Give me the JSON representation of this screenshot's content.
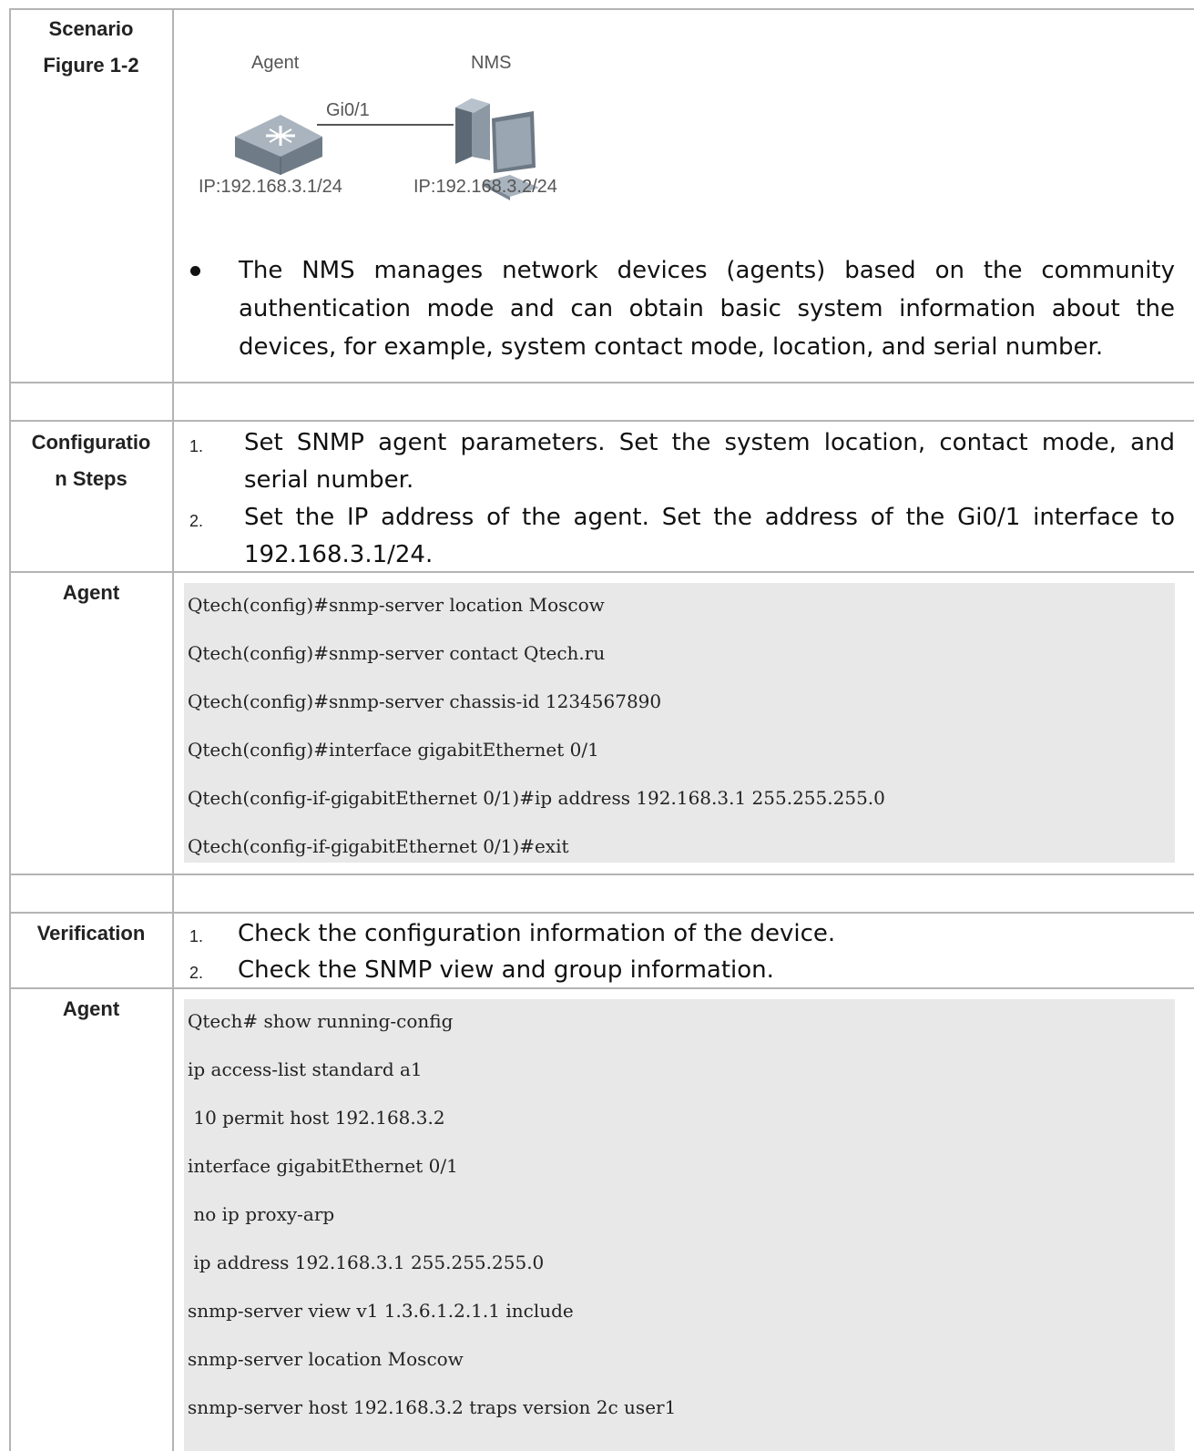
{
  "rows": {
    "scenario": {
      "label_line1": "Scenario",
      "label_line2": "Figure 1-2"
    },
    "config_steps": {
      "label_line1": "Configuratio",
      "label_line2": "n Steps"
    },
    "agent1": {
      "label": "Agent"
    },
    "verification": {
      "label": "Verification"
    },
    "agent2": {
      "label": "Agent"
    }
  },
  "figure": {
    "agent_label": "Agent",
    "nms_label": "NMS",
    "port_label": "Gi0/1",
    "agent_ip": "IP:192.168.3.1/24",
    "nms_ip": "IP:192.168.3.2/24",
    "switch_icon": "switch-icon",
    "pc_icon": "pc-icon"
  },
  "scenario_bullet": "The NMS manages network devices (agents) based on the community authentication mode and can obtain basic system information about the devices, for example, system contact mode, location, and serial number.",
  "config_steps": [
    {
      "num": "1.",
      "text": "Set SNMP agent parameters. Set the system location, contact mode, and serial number."
    },
    {
      "num": "2.",
      "text": "Set the IP address of the agent. Set the address of the Gi0/1 interface to 192.168.3.1/24."
    }
  ],
  "agent_config_code": [
    "Qtech(config)#snmp-server location Moscow",
    "Qtech(config)#snmp-server contact Qtech.ru",
    "Qtech(config)#snmp-server chassis-id 1234567890",
    "Qtech(config)#interface gigabitEthernet 0/1",
    "Qtech(config-if-gigabitEthernet 0/1)#ip address 192.168.3.1 255.255.255.0",
    "Qtech(config-if-gigabitEthernet 0/1)#exit"
  ],
  "verification_steps": [
    {
      "num": "1.",
      "text": "Check the configuration information of the device."
    },
    {
      "num": "2.",
      "text": "Check the SNMP view and group information."
    }
  ],
  "verification_code": [
    "Qtech# show running-config",
    "ip access-list standard a1",
    " 10 permit host 192.168.3.2",
    "interface gigabitEthernet 0/1",
    " no ip proxy-arp",
    " ip address 192.168.3.1 255.255.255.0",
    "snmp-server view v1 1.3.6.1.2.1.1 include",
    "snmp-server location Moscow",
    "snmp-server host 192.168.3.2 traps version 2c user1"
  ]
}
